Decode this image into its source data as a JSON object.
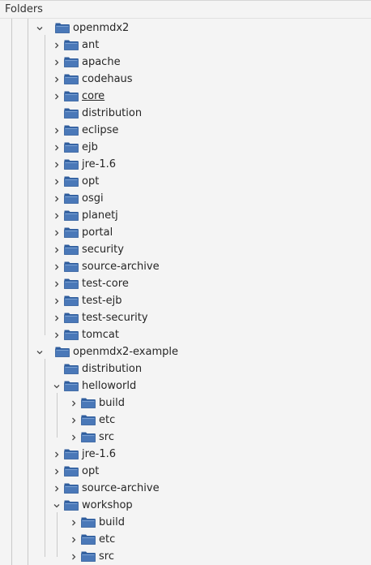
{
  "panel": {
    "title": "Folders"
  },
  "colors": {
    "folder_fill": "#4a78b8",
    "folder_tab": "#2f5d9c",
    "guide_line": "#c9c9c9"
  },
  "tree": [
    {
      "label": "openmdx2",
      "depth": 0,
      "toggle": "expanded",
      "icon": "folder-icon"
    },
    {
      "label": "ant",
      "depth": 1,
      "toggle": "collapsed",
      "icon": "folder-icon"
    },
    {
      "label": "apache",
      "depth": 1,
      "toggle": "collapsed",
      "icon": "folder-icon"
    },
    {
      "label": "codehaus",
      "depth": 1,
      "toggle": "collapsed",
      "icon": "folder-icon"
    },
    {
      "label": "core",
      "depth": 1,
      "toggle": "collapsed",
      "icon": "folder-icon",
      "underlined": true
    },
    {
      "label": "distribution",
      "depth": 1,
      "toggle": "none",
      "icon": "folder-icon"
    },
    {
      "label": "eclipse",
      "depth": 1,
      "toggle": "collapsed",
      "icon": "folder-icon"
    },
    {
      "label": "ejb",
      "depth": 1,
      "toggle": "collapsed",
      "icon": "folder-icon"
    },
    {
      "label": "jre-1.6",
      "depth": 1,
      "toggle": "collapsed",
      "icon": "folder-icon"
    },
    {
      "label": "opt",
      "depth": 1,
      "toggle": "collapsed",
      "icon": "folder-icon"
    },
    {
      "label": "osgi",
      "depth": 1,
      "toggle": "collapsed",
      "icon": "folder-icon"
    },
    {
      "label": "planetj",
      "depth": 1,
      "toggle": "collapsed",
      "icon": "folder-icon"
    },
    {
      "label": "portal",
      "depth": 1,
      "toggle": "collapsed",
      "icon": "folder-icon"
    },
    {
      "label": "security",
      "depth": 1,
      "toggle": "collapsed",
      "icon": "folder-icon"
    },
    {
      "label": "source-archive",
      "depth": 1,
      "toggle": "collapsed",
      "icon": "folder-icon"
    },
    {
      "label": "test-core",
      "depth": 1,
      "toggle": "collapsed",
      "icon": "folder-icon"
    },
    {
      "label": "test-ejb",
      "depth": 1,
      "toggle": "collapsed",
      "icon": "folder-icon"
    },
    {
      "label": "test-security",
      "depth": 1,
      "toggle": "collapsed",
      "icon": "folder-icon"
    },
    {
      "label": "tomcat",
      "depth": 1,
      "toggle": "collapsed",
      "icon": "folder-icon"
    },
    {
      "label": "openmdx2-example",
      "depth": 0,
      "toggle": "expanded",
      "icon": "folder-icon"
    },
    {
      "label": "distribution",
      "depth": 1,
      "toggle": "none",
      "icon": "folder-icon"
    },
    {
      "label": "helloworld",
      "depth": 1,
      "toggle": "expanded",
      "icon": "folder-icon"
    },
    {
      "label": "build",
      "depth": 2,
      "toggle": "collapsed",
      "icon": "folder-icon"
    },
    {
      "label": "etc",
      "depth": 2,
      "toggle": "collapsed",
      "icon": "folder-icon"
    },
    {
      "label": "src",
      "depth": 2,
      "toggle": "collapsed",
      "icon": "folder-icon"
    },
    {
      "label": "jre-1.6",
      "depth": 1,
      "toggle": "collapsed",
      "icon": "folder-icon"
    },
    {
      "label": "opt",
      "depth": 1,
      "toggle": "collapsed",
      "icon": "folder-icon"
    },
    {
      "label": "source-archive",
      "depth": 1,
      "toggle": "collapsed",
      "icon": "folder-icon"
    },
    {
      "label": "workshop",
      "depth": 1,
      "toggle": "expanded",
      "icon": "folder-icon"
    },
    {
      "label": "build",
      "depth": 2,
      "toggle": "collapsed",
      "icon": "folder-icon"
    },
    {
      "label": "etc",
      "depth": 2,
      "toggle": "collapsed",
      "icon": "folder-icon"
    },
    {
      "label": "src",
      "depth": 2,
      "toggle": "collapsed",
      "icon": "folder-icon"
    }
  ]
}
